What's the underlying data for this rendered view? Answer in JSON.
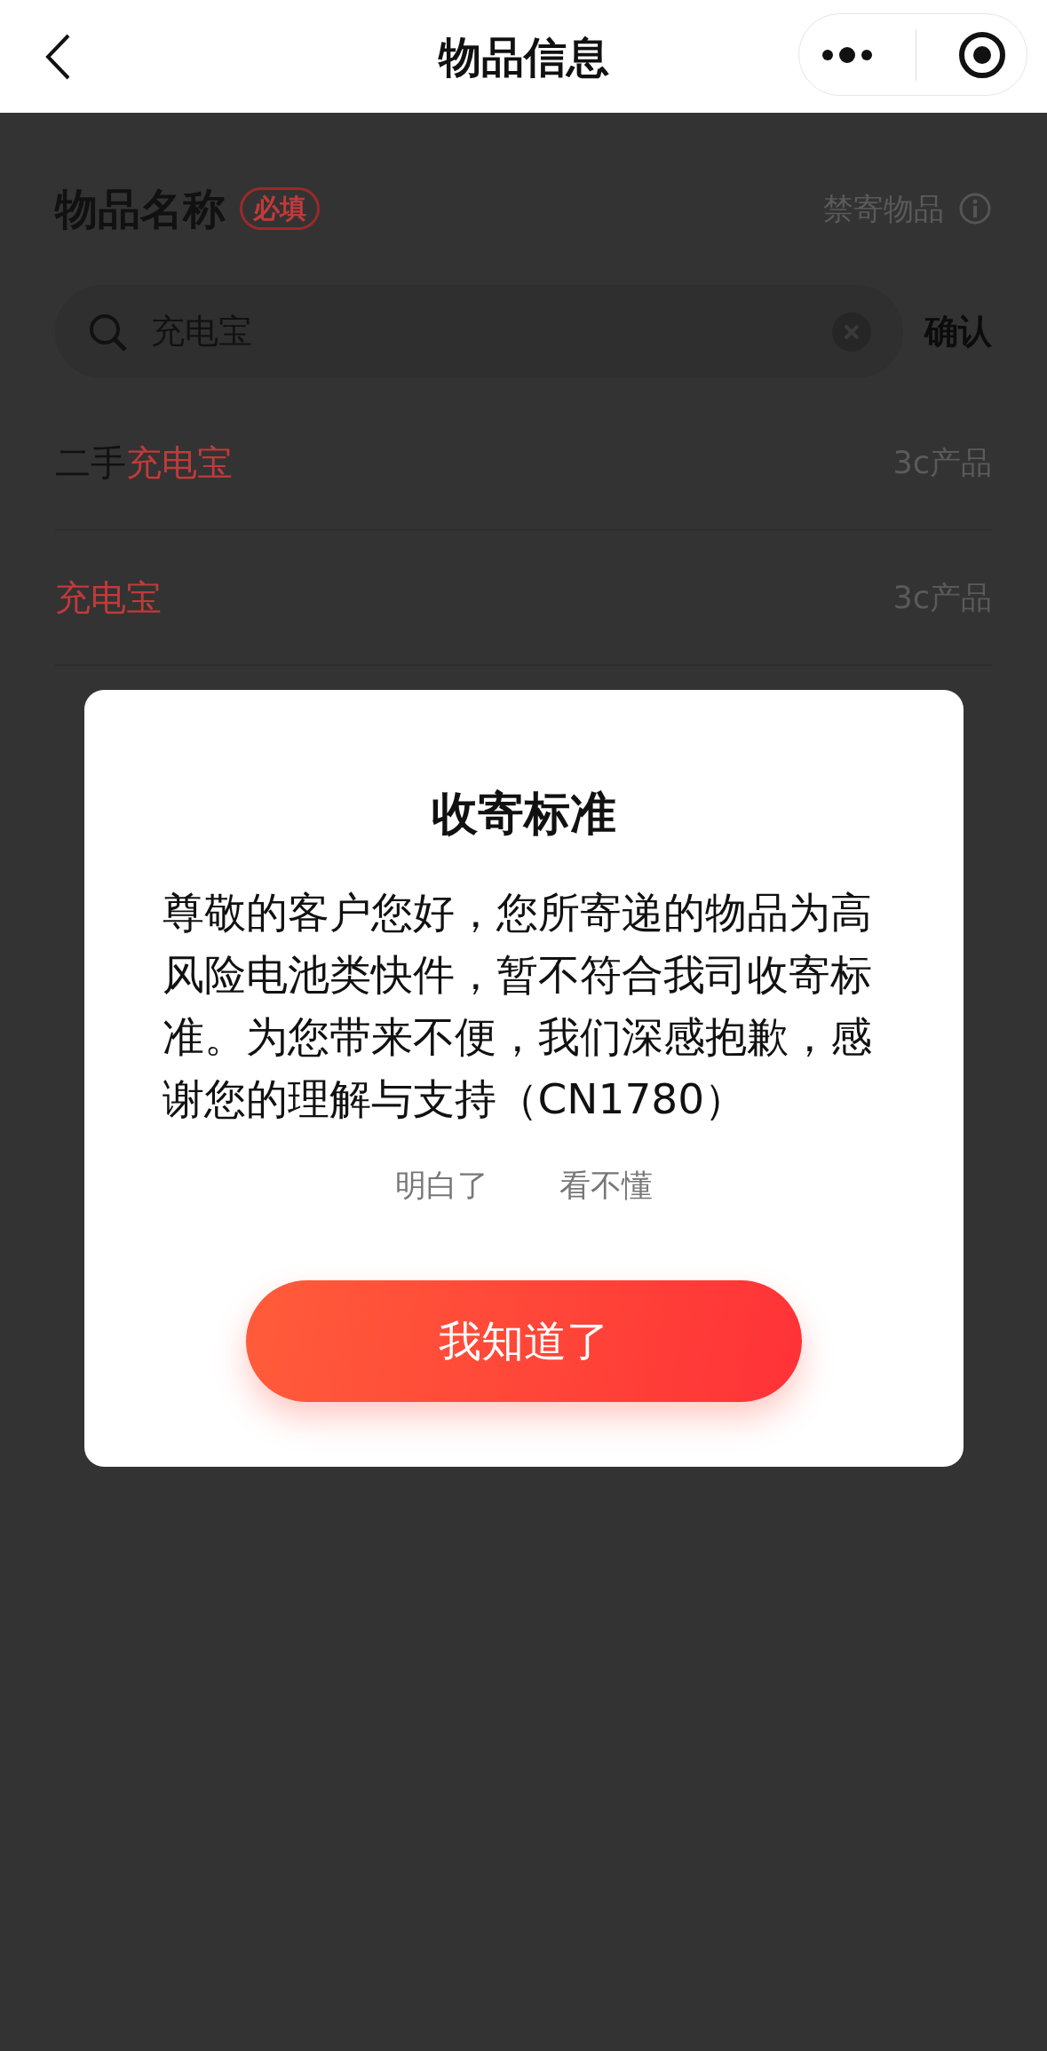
{
  "nav": {
    "title": "物品信息"
  },
  "section": {
    "title": "物品名称",
    "badge": "必填",
    "link": "禁寄物品"
  },
  "search": {
    "value": "充电宝",
    "action": "确认"
  },
  "results": [
    {
      "name": [
        {
          "text": "二手",
          "highlight": false
        },
        {
          "text": "充电宝",
          "highlight": true
        }
      ],
      "category": "3c产品"
    },
    {
      "name": [
        {
          "text": "充电宝",
          "highlight": true
        }
      ],
      "category": "3c产品"
    }
  ],
  "dialog": {
    "title": "收寄标准",
    "message": "尊敬的客户您好，您所寄递的物品为高风险电池类快件，暂不符合我司收寄标准。为您带来不便，我们深感抱歉，感谢您的理解与支持（CN1780）",
    "options": [
      "明白了",
      "看不懂"
    ],
    "button": "我知道了"
  }
}
